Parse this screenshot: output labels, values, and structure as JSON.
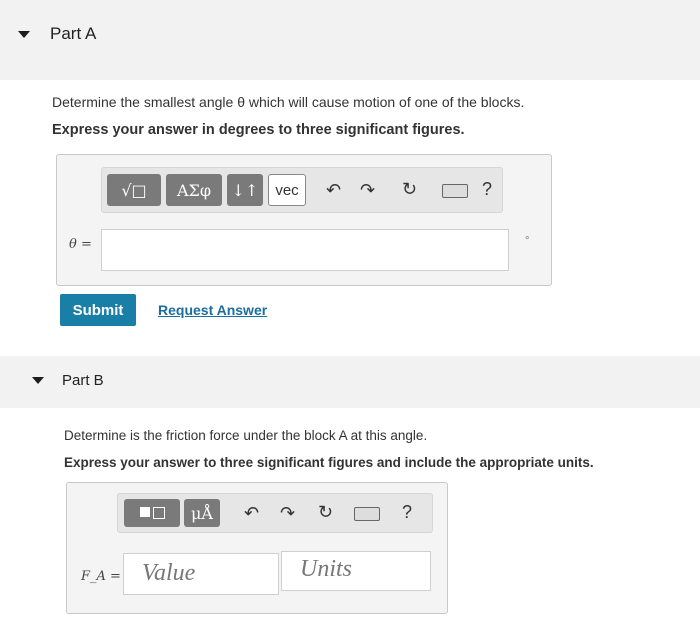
{
  "partA": {
    "title": "Part A",
    "question": "Determine the smallest angle θ which will cause motion of one of the blocks.",
    "instruction": "Express your answer in degrees to three significant figures.",
    "toolbar": {
      "templates_label": "√□",
      "greek_label": "ΑΣφ",
      "sort_label": "↓↑",
      "vec_label": "vec",
      "help_label": "?"
    },
    "input_label": "θ =",
    "unit_symbol": "°",
    "submit_label": "Submit",
    "request_label": "Request Answer"
  },
  "partB": {
    "title": "Part B",
    "question": "Determine is the friction force under the block A at this angle.",
    "instruction": "Express your answer to three significant figures and include the appropriate units.",
    "toolbar": {
      "units_label": "μÅ",
      "help_label": "?"
    },
    "input_label": "F_A =",
    "value_placeholder": "Value",
    "units_placeholder": "Units"
  }
}
